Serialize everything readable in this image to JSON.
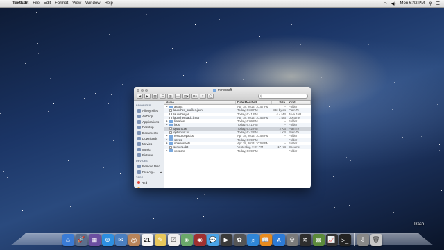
{
  "menubar": {
    "app_name": "TextEdit",
    "items": [
      "File",
      "Edit",
      "Format",
      "View",
      "Window",
      "Help"
    ],
    "clock": "Mon 6:42 PM",
    "status_icons": [
      "wifi-icon",
      "volume-icon",
      "spotlight-icon",
      "notification-icon"
    ]
  },
  "window": {
    "title": "minecraft",
    "search_placeholder": "",
    "sidebar": {
      "favorites_header": "FAVORITES",
      "favorites": [
        {
          "label": "All My Files",
          "icon": "all-files-icon"
        },
        {
          "label": "AirDrop",
          "icon": "airdrop-icon"
        },
        {
          "label": "Applications",
          "icon": "applications-icon"
        },
        {
          "label": "Desktop",
          "icon": "desktop-icon"
        },
        {
          "label": "Documents",
          "icon": "documents-icon"
        },
        {
          "label": "Downloads",
          "icon": "downloads-icon"
        },
        {
          "label": "Movies",
          "icon": "movies-icon"
        },
        {
          "label": "Music",
          "icon": "music-icon"
        },
        {
          "label": "Pictures",
          "icon": "pictures-icon"
        }
      ],
      "devices_header": "DEVICES",
      "devices": [
        {
          "label": "Remote Disc",
          "icon": "remote-disc-icon"
        },
        {
          "label": "FreeAg...",
          "icon": "drive-icon"
        }
      ],
      "tags_header": "TAGS",
      "tags": [
        {
          "label": "Red",
          "color": "#e0443a"
        },
        {
          "label": "Orange",
          "color": "#f29b2c"
        }
      ]
    },
    "columns": {
      "name": "Name",
      "date": "Date Modified",
      "size": "Size",
      "kind": "Kind"
    },
    "files": [
      {
        "name": "assets",
        "type": "folder",
        "date": "Apr 18, 2014, 10:57 PM",
        "size": "--",
        "kind": "Folder"
      },
      {
        "name": "launcher_profiles.json",
        "type": "file",
        "date": "Today, 6:33 PM",
        "size": "843 bytes",
        "kind": "Plain Te"
      },
      {
        "name": "launcher.jar",
        "type": "file",
        "date": "Today, 6:41 PM",
        "size": "4.4 MB",
        "kind": "Java JAR"
      },
      {
        "name": "launcher.pack.lzma",
        "type": "file",
        "date": "Apr 18, 2014, 10:55 PM",
        "size": "1 MB",
        "kind": "Docume"
      },
      {
        "name": "libraries",
        "type": "folder",
        "date": "Today, 6:09 PM",
        "size": "--",
        "kind": "Folder"
      },
      {
        "name": "logs",
        "type": "folder",
        "date": "Today, 6:41 PM",
        "size": "--",
        "kind": "Folder"
      },
      {
        "name": "options.txt",
        "type": "file",
        "date": "Today, 6:42 PM",
        "size": "2 KB",
        "kind": "Plain Te"
      },
      {
        "name": "optionsof.txt",
        "type": "file",
        "date": "Today, 6:42 PM",
        "size": "1 KB",
        "kind": "Plain Te"
      },
      {
        "name": "resourcepacks",
        "type": "folder",
        "date": "Apr 18, 2014, 10:58 PM",
        "size": "--",
        "kind": "Folder"
      },
      {
        "name": "saves",
        "type": "folder",
        "date": "Today, 6:09 PM",
        "size": "--",
        "kind": "Folder"
      },
      {
        "name": "screenshots",
        "type": "folder",
        "date": "Apr 18, 2014, 10:58 PM",
        "size": "--",
        "kind": "Folder"
      },
      {
        "name": "servers.dat",
        "type": "file",
        "date": "Yesterday, 7:07 PM",
        "size": "17 KB",
        "kind": "Docume"
      },
      {
        "name": "versions",
        "type": "folder",
        "date": "Today, 6:09 PM",
        "size": "--",
        "kind": "Folder"
      }
    ],
    "selected_file": "options.txt"
  },
  "dock": {
    "trash_label": "Trash",
    "calendar_day": "21",
    "apps": [
      {
        "name": "finder-icon",
        "color": "#3a7bd5",
        "glyph": "☺"
      },
      {
        "name": "launchpad-icon",
        "color": "#5c6f8c",
        "glyph": "🚀"
      },
      {
        "name": "mission-control-icon",
        "color": "#6b4fa0",
        "glyph": "▦"
      },
      {
        "name": "safari-icon",
        "color": "#2d8fe0",
        "glyph": "⊕"
      },
      {
        "name": "mail-icon",
        "color": "#4a7fc0",
        "glyph": "✉"
      },
      {
        "name": "contacts-icon",
        "color": "#b8845a",
        "glyph": "@"
      },
      {
        "name": "calendar-icon",
        "color": "#f4f4f4",
        "glyph": ""
      },
      {
        "name": "notes-icon",
        "color": "#e8c85c",
        "glyph": "✎"
      },
      {
        "name": "reminders-icon",
        "color": "#eeeeee",
        "glyph": "☑"
      },
      {
        "name": "maps-icon",
        "color": "#6aa86a",
        "glyph": "◈"
      },
      {
        "name": "photo-booth-icon",
        "color": "#a03030",
        "glyph": "◉"
      },
      {
        "name": "messages-icon",
        "color": "#4aa3e8",
        "glyph": "💬"
      },
      {
        "name": "facetime-icon",
        "color": "#3a3a3a",
        "glyph": "▶"
      },
      {
        "name": "photos-icon",
        "color": "#555555",
        "glyph": "✿"
      },
      {
        "name": "itunes-icon",
        "color": "#2f86d8",
        "glyph": "♫"
      },
      {
        "name": "ibooks-icon",
        "color": "#e58a1f",
        "glyph": "📖"
      },
      {
        "name": "app-store-icon",
        "color": "#2c7ad6",
        "glyph": "A"
      },
      {
        "name": "system-preferences-icon",
        "color": "#7a7a7a",
        "glyph": "⚙"
      },
      {
        "name": "spotify-icon",
        "color": "#2e2e2e",
        "glyph": "≋"
      },
      {
        "name": "minecraft-icon",
        "color": "#5b8a3a",
        "glyph": "▩"
      },
      {
        "name": "activity-monitor-icon",
        "color": "#333333",
        "glyph": "📈"
      },
      {
        "name": "terminal-icon",
        "color": "#222222",
        "glyph": ">_"
      }
    ],
    "stacks": [
      {
        "name": "downloads-stack-icon",
        "color": "#888888",
        "glyph": "⇩"
      },
      {
        "name": "trash-icon",
        "color": "#c8c8c8",
        "glyph": "🗑"
      }
    ]
  }
}
